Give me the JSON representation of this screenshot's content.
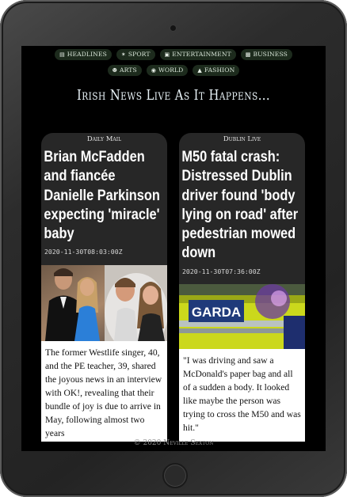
{
  "nav": {
    "items": [
      {
        "label": "HEADLINES",
        "icon": "newspaper-icon"
      },
      {
        "label": "SPORT",
        "icon": "runner-icon"
      },
      {
        "label": "ENTERTAINMENT",
        "icon": "film-icon"
      },
      {
        "label": "BUSINESS",
        "icon": "building-icon"
      },
      {
        "label": "ARTS",
        "icon": "theater-masks-icon"
      },
      {
        "label": "WORLD",
        "icon": "globe-icon"
      },
      {
        "label": "FASHION",
        "icon": "hat-icon"
      }
    ]
  },
  "page": {
    "title": "Irish News Live As It Happens...",
    "footer": "© 2020 Neville Sexton"
  },
  "articles": [
    {
      "source": "Daily Mail",
      "headline": "Brian McFadden and fiancée Danielle Parkinson expecting 'miracle' baby",
      "date": "2020-11-30T08:03:00Z",
      "excerpt": "The former Westlife singer, 40, and the PE teacher, 39, shared the joyous news in an interview with OK!, revealing that their bundle of joy is due to arrive in May, following almost two years"
    },
    {
      "source": "Dublin Live",
      "headline": "M50 fatal crash: Distressed Dublin driver found 'body lying on road' after pedestrian mowed down",
      "date": "2020-11-30T07:36:00Z",
      "excerpt": "\"I was driving and saw a McDonald's paper bag and all of a sudden a body. It looked like maybe the person was trying to cross the M50 and was hit.\"",
      "photo_text": "GARDA"
    }
  ],
  "colors": {
    "screen_bg": "#000000",
    "chip_bg": "#1d2b1d",
    "card_bg": "#272727",
    "garda_yellow": "#d6e21e",
    "garda_blue": "#1f3a7a"
  }
}
